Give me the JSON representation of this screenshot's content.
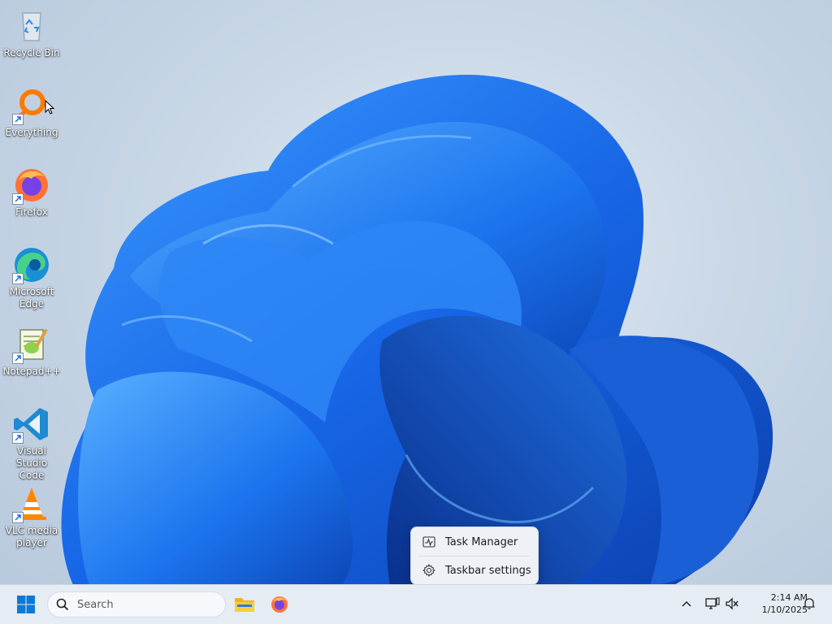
{
  "desktop": {
    "icons": [
      {
        "label": "Recycle Bin",
        "icon": "recycle-bin-icon"
      },
      {
        "label": "Everything",
        "icon": "everything-search-icon"
      },
      {
        "label": "Firefox",
        "icon": "firefox-icon"
      },
      {
        "label": "Microsoft Edge",
        "icon": "edge-icon"
      },
      {
        "label": "Notepad++",
        "icon": "notepad-plus-plus-icon"
      },
      {
        "label": "Visual Studio Code",
        "icon": "vscode-icon"
      },
      {
        "label": "VLC media player",
        "icon": "vlc-icon"
      }
    ]
  },
  "context_menu": {
    "items": [
      {
        "label": "Task Manager",
        "icon": "task-manager-icon"
      },
      {
        "label": "Taskbar settings",
        "icon": "gear-icon"
      }
    ]
  },
  "taskbar": {
    "search_placeholder": "Search",
    "pinned": [
      {
        "name": "File Explorer",
        "icon": "folder-icon"
      },
      {
        "name": "Firefox",
        "icon": "firefox-icon"
      }
    ],
    "tray": {
      "time": "2:14 AM",
      "date": "1/10/2025"
    }
  },
  "colors": {
    "wallpaper_blue": "#1f6fe0",
    "taskbar_bg": "#e6ecf3",
    "accent": "#0067c0"
  }
}
